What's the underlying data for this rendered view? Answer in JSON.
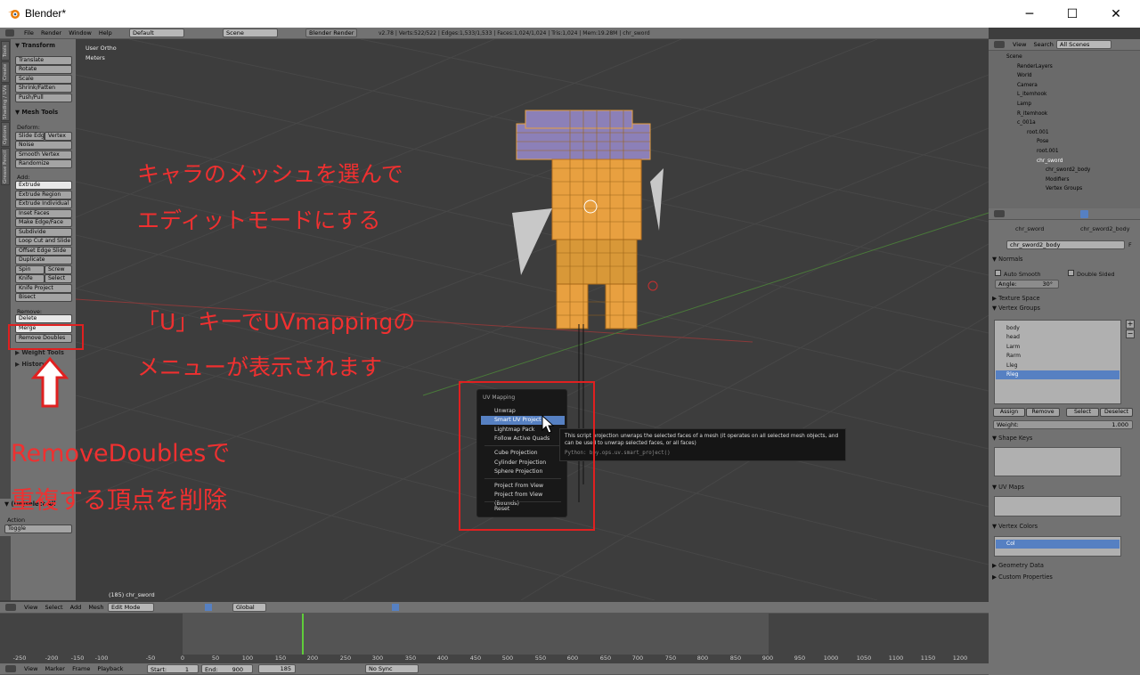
{
  "window": {
    "title": "Blender*",
    "minimize": "─",
    "maximize": "☐",
    "close": "✕"
  },
  "top_header": {
    "menus": [
      "File",
      "Render",
      "Window",
      "Help"
    ],
    "layout": "Default",
    "scene": "Scene",
    "engine": "Blender Render",
    "stats": "v2.78 | Verts:522/522 | Edges:1,533/1,533 | Faces:1,024/1,024 | Tris:1,024 | Mem:19.28M | chr_sword"
  },
  "tool_tabs": [
    "Tools",
    "Create",
    "Shading / UVs",
    "Options",
    "Grease Pencil"
  ],
  "tools": {
    "transform_title": "Transform",
    "transform": [
      "Translate",
      "Rotate",
      "Scale",
      "Shrink/Fatten",
      "Push/Pull"
    ],
    "mesh_tools_title": "Mesh Tools",
    "deform_label": "Deform:",
    "slide_edge": "Slide Edge",
    "vertex": "Vertex",
    "deform": [
      "Noise",
      "Smooth Vertex",
      "Randomize"
    ],
    "add_label": "Add:",
    "extrude": "Extrude",
    "add": [
      "Extrude Region",
      "Extrude Individual",
      "Inset Faces",
      "Make Edge/Face",
      "Subdivide",
      "Loop Cut and Slide",
      "Offset Edge Slide",
      "Duplicate"
    ],
    "spin": "Spin",
    "screw": "Screw",
    "knife": "Knife",
    "select": "Select",
    "add2": [
      "Knife Project",
      "Bisect"
    ],
    "remove_label": "Remove:",
    "delete": "Delete",
    "merge": "Merge",
    "remove_doubles": "Remove Doubles",
    "weight_tools": "Weight Tools",
    "history": "History",
    "operator_title": "(De)select All",
    "action_label": "Action",
    "action_value": "Toggle"
  },
  "viewport": {
    "view_name": "User Ortho",
    "units": "Meters",
    "object_info": "(185) chr_sword"
  },
  "annotations": {
    "line1": "キャラのメッシュを選んで",
    "line2": "エディットモードにする",
    "line3": "「U」キーでUVmappingの",
    "line4": "メニューが表示されます",
    "line5": "RemoveDoublesで",
    "line6": "重複する頂点を削除"
  },
  "uv_menu": {
    "title": "UV Mapping",
    "items": [
      "Unwrap",
      "Smart UV Project",
      "Lightmap Pack",
      "Follow Active Quads",
      "Cube Projection",
      "Cylinder Projection",
      "Sphere Projection",
      "Project From View",
      "Project from View (Bounds)",
      "Reset"
    ],
    "selected": "Smart UV Project"
  },
  "tooltip": {
    "text": "This script projection unwraps the selected faces of a mesh (it operates on all selected mesh objects, and can be used to unwrap selected faces, or all faces)",
    "python": "Python: bpy.ops.uv.smart_project()"
  },
  "view3d_header": {
    "menus": [
      "View",
      "Select",
      "Add",
      "Mesh"
    ],
    "mode": "Edit Mode",
    "orientation": "Global"
  },
  "timeline": {
    "ticks": [
      "-250",
      "-200",
      "-150",
      "-100",
      "-50",
      "0",
      "50",
      "100",
      "150",
      "200",
      "250",
      "300",
      "350",
      "400",
      "450",
      "500",
      "550",
      "600",
      "650",
      "700",
      "750",
      "800",
      "850",
      "900",
      "950",
      "1000",
      "1050",
      "1100",
      "1150",
      "1200"
    ],
    "menus": [
      "View",
      "Marker",
      "Frame",
      "Playback"
    ],
    "start": "Start:",
    "start_val": "1",
    "end": "End:",
    "end_val": "900",
    "current": "185",
    "sync": "No Sync"
  },
  "outliner": {
    "menus": [
      "View",
      "Search"
    ],
    "filter": "All Scenes",
    "items": [
      "Scene",
      "RenderLayers",
      "World",
      "Camera",
      "L_itemhook",
      "Lamp",
      "R_itemhook",
      "c_001a",
      "root.001",
      "Pose",
      "root.001",
      "chr_sword",
      "chr_sword2_body",
      "Modifiers",
      "Vertex Groups"
    ]
  },
  "properties": {
    "breadcrumb1": "chr_sword",
    "breadcrumb2": "chr_sword2_body",
    "mesh_name": "chr_sword2_body",
    "mesh_f": "F",
    "normals": "Normals",
    "auto_smooth": "Auto Smooth",
    "double_sided": "Double Sided",
    "angle": "Angle:",
    "angle_val": "30°",
    "texture_space": "Texture Space",
    "vertex_groups": "Vertex Groups",
    "vg_items": [
      "body",
      "head",
      "Larm",
      "Rarm",
      "Lleg",
      "Rleg"
    ],
    "vg_selected": "Rleg",
    "assign": "Assign",
    "remove": "Remove",
    "select": "Select",
    "deselect": "Deselect",
    "weight": "Weight:",
    "weight_val": "1.000",
    "shape_keys": "Shape Keys",
    "uv_maps": "UV Maps",
    "vertex_colors": "Vertex Colors",
    "vc_item": "Col",
    "geometry_data": "Geometry Data",
    "custom_properties": "Custom Properties"
  },
  "colors": {
    "annotation": "#e02020",
    "selection": "#5680c2",
    "mesh_orange": "#e8a040",
    "mesh_purple": "#8c80b8"
  }
}
